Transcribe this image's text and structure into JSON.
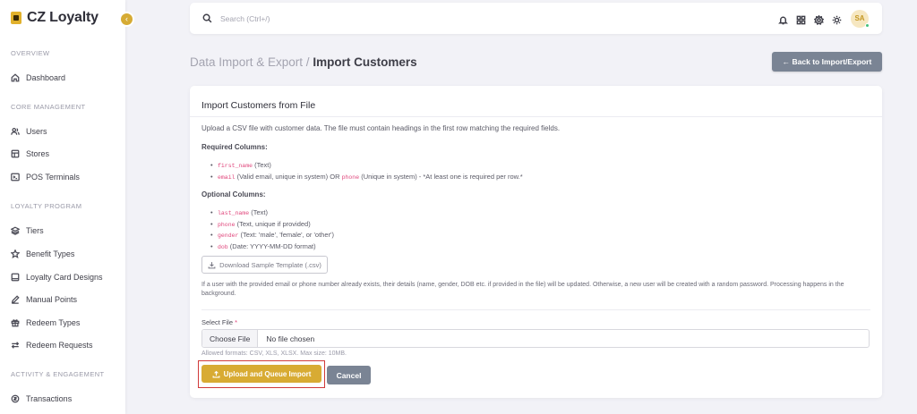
{
  "brand": {
    "name": "CZ Loyalty",
    "collapse_glyph": "‹"
  },
  "sidebar": {
    "sections": [
      {
        "label": "OVERVIEW",
        "items": [
          {
            "label": "Dashboard",
            "icon": "home-icon"
          }
        ]
      },
      {
        "label": "CORE MANAGEMENT",
        "items": [
          {
            "label": "Users",
            "icon": "users-icon"
          },
          {
            "label": "Stores",
            "icon": "store-icon"
          },
          {
            "label": "POS Terminals",
            "icon": "terminal-icon"
          }
        ]
      },
      {
        "label": "LOYALTY PROGRAM",
        "items": [
          {
            "label": "Tiers",
            "icon": "layers-icon"
          },
          {
            "label": "Benefit Types",
            "icon": "star-icon"
          },
          {
            "label": "Loyalty Card Designs",
            "icon": "card-icon"
          },
          {
            "label": "Manual Points",
            "icon": "edit-icon"
          },
          {
            "label": "Redeem Types",
            "icon": "gift-icon"
          },
          {
            "label": "Redeem Requests",
            "icon": "swap-icon"
          }
        ]
      },
      {
        "label": "ACTIVITY & ENGAGEMENT",
        "items": [
          {
            "label": "Transactions",
            "icon": "transactions-icon"
          }
        ]
      }
    ]
  },
  "topbar": {
    "search_placeholder": "Search (Ctrl+/)",
    "icons": [
      "bell-icon",
      "grid-icon",
      "gear-icon",
      "sun-icon"
    ],
    "avatar_initials": "SA"
  },
  "header": {
    "breadcrumb_parent": "Data Import & Export /",
    "breadcrumb_current": "Import Customers",
    "back_label": "← Back to Import/Export"
  },
  "card": {
    "title": "Import Customers from File",
    "intro": "Upload a CSV file with customer data. The file must contain headings in the first row matching the required fields.",
    "required_heading": "Required Columns:",
    "required": [
      {
        "code": "first_name",
        "desc": " (Text)"
      },
      {
        "code": "email",
        "desc": " (Valid email, unique in system) OR ",
        "code2": "phone",
        "desc2": " (Unique in system) - *At least one is required per row.*"
      }
    ],
    "optional_heading": "Optional Columns:",
    "optional": [
      {
        "code": "last_name",
        "desc": " (Text)"
      },
      {
        "code": "phone",
        "desc": " (Text, unique if provided)"
      },
      {
        "code": "gender",
        "desc": " (Text: 'male', 'female', or 'other')"
      },
      {
        "code": "dob",
        "desc": " (Date: YYYY-MM-DD format)"
      }
    ],
    "download_label": "Download Sample Template (.csv)",
    "note": "If a user with the provided email or phone number already exists, their details (name, gender, DOB etc. if provided in the file) will be updated. Otherwise, a new user will be created with a random password. Processing happens in the background.",
    "file_label": "Select File",
    "required_mark": "*",
    "choose_label": "Choose File",
    "no_file_label": "No file chosen",
    "hint": "Allowed formats: CSV, XLS, XLSX. Max size: 10MB.",
    "upload_label": "Upload and Queue Import",
    "cancel_label": "Cancel"
  },
  "colors": {
    "accent": "#d8ab33",
    "secondary": "#7a8494",
    "highlight": "#d13a3a",
    "code": "#e0457b"
  }
}
